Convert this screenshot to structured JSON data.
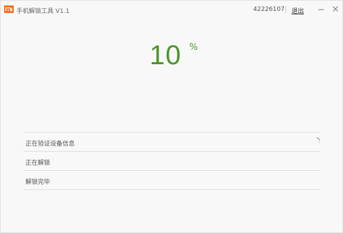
{
  "titlebar": {
    "app_title": "手机解锁工具  V1.1",
    "user_id": "42226107",
    "logout_label": "退出",
    "icons": {
      "logo": "mi-logo-icon",
      "minimize": "minimize-icon",
      "close": "close-icon"
    }
  },
  "progress": {
    "value": "10",
    "unit": "%",
    "color": "#4a9626"
  },
  "steps": [
    {
      "label": "正在验证设备信息",
      "state": "in-progress"
    },
    {
      "label": "正在解锁",
      "state": "pending"
    },
    {
      "label": "解锁完毕",
      "state": "pending"
    }
  ],
  "colors": {
    "brand": "#f26b1d",
    "progress_text": "#4a9626"
  }
}
